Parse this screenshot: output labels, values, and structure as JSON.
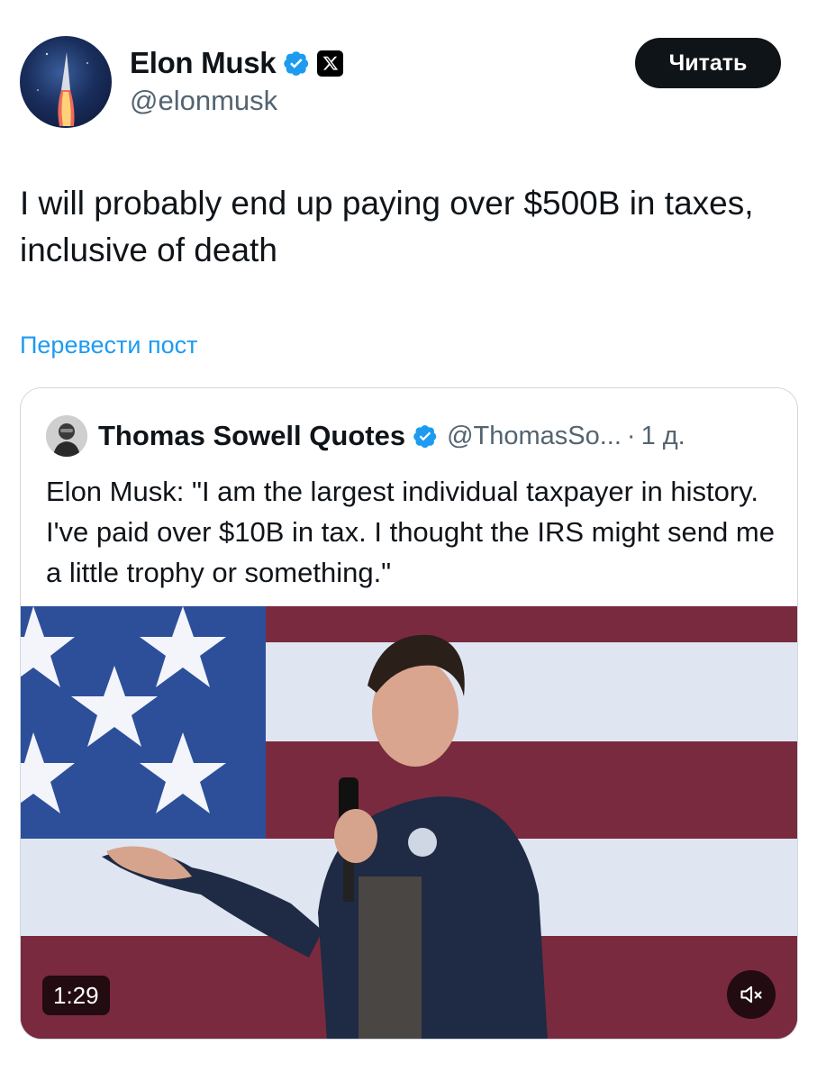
{
  "post": {
    "author": {
      "display_name": "Elon Musk",
      "handle": "@elonmusk",
      "verified_icon": "verified-badge-icon",
      "affiliate_icon": "x-logo-icon"
    },
    "read_button_label": "Читать",
    "text": "I will probably end up paying over $500B in taxes, inclusive of death",
    "translate_label": "Перевести пост"
  },
  "quoted_post": {
    "author": {
      "display_name": "Thomas Sowell Quotes",
      "handle": "@ThomasSo...",
      "time": "1 д.",
      "verified_icon": "verified-badge-icon"
    },
    "meta_separator": "·",
    "text": "Elon Musk: \"I am the largest individual taxpayer in history. I've paid over $10B in tax. I thought the IRS might send me a little trophy or something.\"",
    "video": {
      "duration": "1:29",
      "mute_icon": "speaker-muted-icon"
    }
  },
  "colors": {
    "link": "#1d9bf0",
    "verified": "#1d9bf0",
    "text": "#0f1419",
    "secondary_text": "#536471",
    "flag_red": "#7a2a3e",
    "flag_blue": "#2d4f9a"
  }
}
